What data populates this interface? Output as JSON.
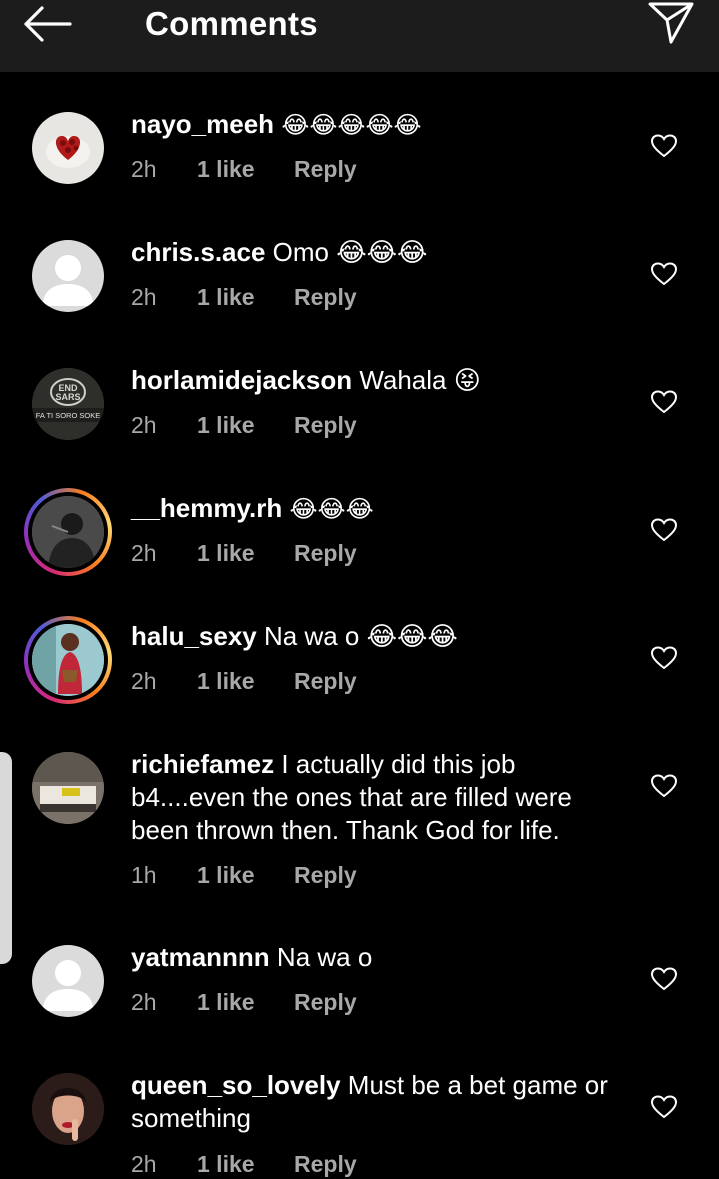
{
  "header": {
    "title": "Comments",
    "back_icon": "arrow-left-icon",
    "send_icon": "paper-plane-icon"
  },
  "comments": [
    {
      "username": "nayo_meeh",
      "text": "😂😂😂😂😂",
      "time": "2h",
      "likes": "1 like",
      "reply": "Reply",
      "avatar": "rose-bouquet-photo",
      "story_ring": false
    },
    {
      "username": "chris.s.ace",
      "text": "Omo 😂😂😂",
      "time": "2h",
      "likes": "1 like",
      "reply": "Reply",
      "avatar": "default-avatar",
      "story_ring": false
    },
    {
      "username": "horlamidejackson",
      "text": "Wahala 😝",
      "time": "2h",
      "likes": "1 like",
      "reply": "Reply",
      "avatar": "endsars-badge",
      "story_ring": false,
      "avatar_text": "END SARS",
      "avatar_subtext": "FA TI SORO SOKE"
    },
    {
      "username": "__hemmy.rh",
      "text": "😂😂😂",
      "time": "2h",
      "likes": "1 like",
      "reply": "Reply",
      "avatar": "person-photo-bw",
      "story_ring": true
    },
    {
      "username": "halu_sexy",
      "text": "Na wa o 😂😂😂",
      "time": "2h",
      "likes": "1 like",
      "reply": "Reply",
      "avatar": "person-photo-color",
      "story_ring": true
    },
    {
      "username": "richiefamez",
      "text": "I actually did this job b4....even the ones that are filled were been thrown then. Thank God for life.",
      "time": "1h",
      "likes": "1 like",
      "reply": "Reply",
      "avatar": "bedroom-photo",
      "story_ring": false
    },
    {
      "username": "yatmannnn",
      "text": "Na wa o",
      "time": "2h",
      "likes": "1 like",
      "reply": "Reply",
      "avatar": "default-avatar",
      "story_ring": false
    },
    {
      "username": "queen_so_lovely",
      "text": "Must be a bet game or something",
      "time": "2h",
      "likes": "1 like",
      "reply": "Reply",
      "avatar": "portrait-photo",
      "story_ring": false
    }
  ],
  "colors": {
    "background": "#000000",
    "header": "#1c1c1c",
    "meta_text": "#a8a8a8",
    "default_avatar": "#dbdbdb"
  }
}
